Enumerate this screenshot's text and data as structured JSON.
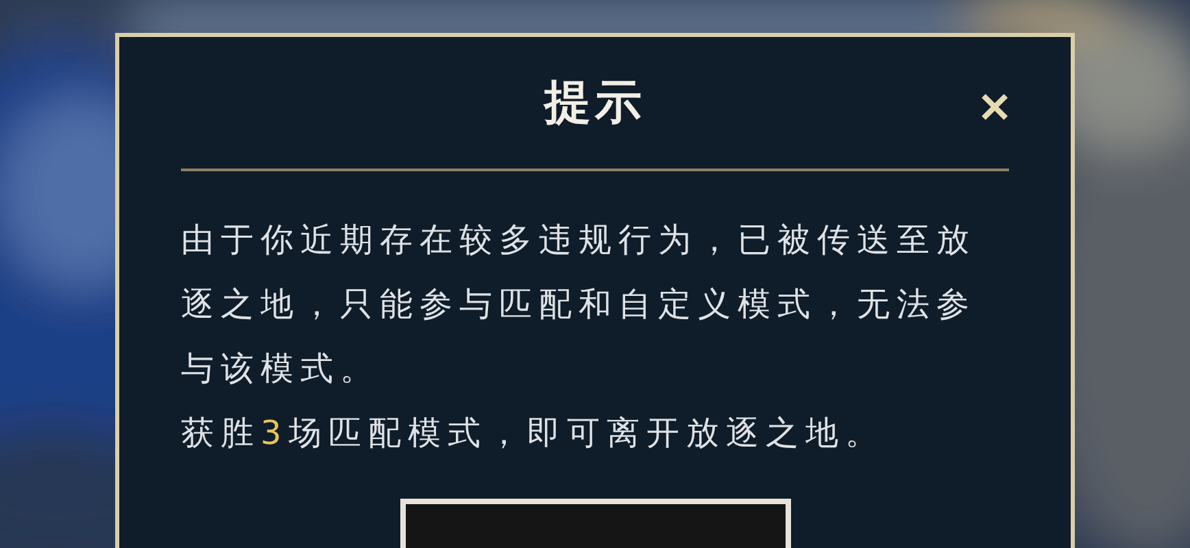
{
  "dialog": {
    "title": "提示",
    "close": "✕",
    "message": "由于你近期存在较多违规行为，已被传送至放逐之地，只能参与匹配和自定义模式，无法参与该模式。",
    "condition": [
      {
        "text": "获胜",
        "highlight": false
      },
      {
        "text": "3",
        "highlight": true
      },
      {
        "text": "场匹配模式，即可离开放逐之地。",
        "highlight": false
      }
    ],
    "button": {
      "kind": "button"
    }
  }
}
